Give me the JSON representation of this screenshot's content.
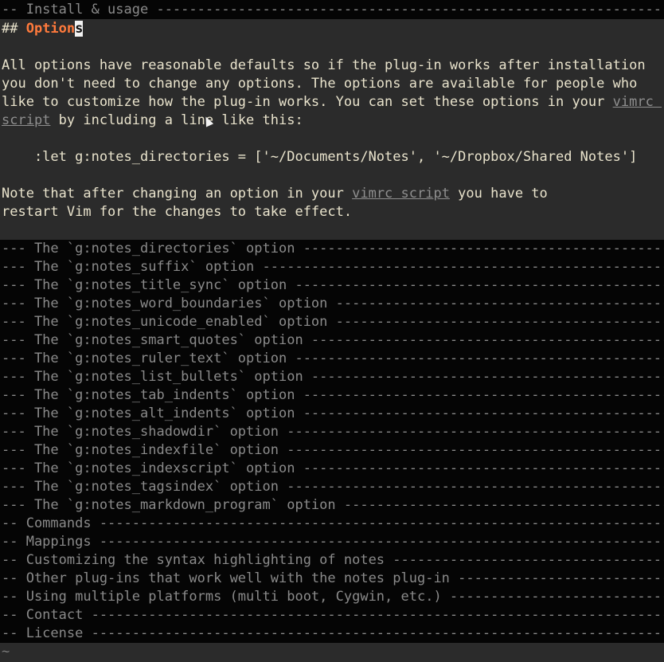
{
  "top_fold": "-- Install & usage ---------------------------------------------------------------------",
  "heading": {
    "marker": "## ",
    "text_before_cursor": "Option",
    "cursor_char": "s"
  },
  "paragraph1": {
    "line1": "All options have reasonable defaults so if the plug-in works after installation",
    "line2": "you don't need to change any options. The options are available for people who",
    "line3_text": "like to customize how the plug-in works. You can set these options in your ",
    "line3_link": "vimrc ",
    "line4_link": "script",
    "line4_text": " by including a line like this:"
  },
  "code_line": "    :let g:notes_directories = ['~/Documents/Notes', '~/Dropbox/Shared Notes']",
  "paragraph2": {
    "line1_text": "Note that after changing an option in your ",
    "line1_link": "vimrc script",
    "line1_end": " you have to",
    "line2": "restart Vim for the changes to take effect."
  },
  "folds": [
    "--- The `g:notes_directories` option -------------------------------------------------------",
    "--- The `g:notes_suffix` option -----------------------------------------------------------",
    "--- The `g:notes_title_sync` option -------------------------------------------------------",
    "--- The `g:notes_word_boundaries` option --------------------------------------------------",
    "--- The `g:notes_unicode_enabled` option --------------------------------------------------",
    "--- The `g:notes_smart_quotes` option -----------------------------------------------------",
    "--- The `g:notes_ruler_text` option -------------------------------------------------------",
    "--- The `g:notes_list_bullets` option -----------------------------------------------------",
    "--- The `g:notes_tab_indents` option ------------------------------------------------------",
    "--- The `g:notes_alt_indents` option ------------------------------------------------------",
    "--- The `g:notes_shadowdir` option --------------------------------------------------------",
    "--- The `g:notes_indexfile` option --------------------------------------------------------",
    "--- The `g:notes_indexscript` option ------------------------------------------------------",
    "--- The `g:notes_tagsindex` option --------------------------------------------------------",
    "--- The `g:notes_markdown_program` option -------------------------------------------------",
    "-- Commands -------------------------------------------------------------------------------",
    "-- Mappings -------------------------------------------------------------------------------",
    "-- Customizing the syntax highlighting of notes -------------------------------------------",
    "-- Other plug-ins that work well with the notes plug-in -----------------------------------",
    "-- Using multiple platforms (multi boot, Cygwin, etc.) ------------------------------------",
    "-- Contact --------------------------------------------------------------------------------",
    "-- License --------------------------------------------------------------------------------"
  ],
  "end_marker": "~"
}
